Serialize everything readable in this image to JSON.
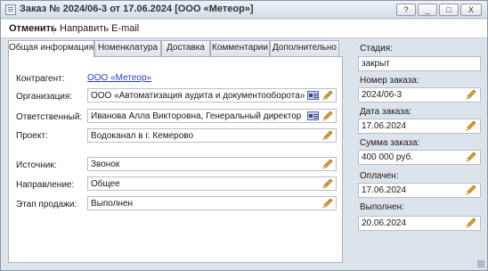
{
  "window": {
    "title": "Заказ № 2024/06-3 от 17.06.2024 [ООО «Метеор»]",
    "buttons": [
      "?",
      "_",
      "□",
      "X"
    ]
  },
  "toolbar": {
    "cancel_label": "Отменить",
    "email_label": "Направить E-mail"
  },
  "tabs": [
    {
      "label": "Общая информация",
      "active": true
    },
    {
      "label": "Номенклатура",
      "active": false
    },
    {
      "label": "Доставка",
      "active": false
    },
    {
      "label": "Комментарии",
      "active": false
    },
    {
      "label": "Дополнительно",
      "active": false
    }
  ],
  "form": {
    "counterparty": {
      "label": "Контрагент:",
      "value": "ООО «Метеор»"
    },
    "organization": {
      "label": "Организация:",
      "value": "ООО «Автоматизация аудита и документооборота»"
    },
    "responsible": {
      "label": "Ответственный:",
      "value": "Иванова Алла Викторовна, Генеральный директор"
    },
    "project": {
      "label": "Проект:",
      "value": "Водоканал в г. Кемерово"
    },
    "source": {
      "label": "Источник:",
      "value": "Звонок"
    },
    "direction": {
      "label": "Направление:",
      "value": "Общее"
    },
    "sales_stage": {
      "label": "Этап продажи:",
      "value": "Выполнен"
    }
  },
  "side": {
    "stage": {
      "label": "Стадия:",
      "value": "закрыт"
    },
    "order_number": {
      "label": "Номер заказа:",
      "value": "2024/06-3"
    },
    "order_date": {
      "label": "Дата заказа:",
      "value": "17.06.2024"
    },
    "order_sum": {
      "label": "Сумма заказа:",
      "value": "400 000 руб."
    },
    "paid": {
      "label": "Оплачен:",
      "value": "17.06.2024"
    },
    "done": {
      "label": "Выполнен:",
      "value": "20.06.2024"
    }
  },
  "colors": {
    "link": "#1f3fc0",
    "window_bg": "#dde3ea",
    "pencil": "#e0a020"
  },
  "icons": {
    "edit": "pencil-icon",
    "contact_card": "contact-card-icon"
  }
}
